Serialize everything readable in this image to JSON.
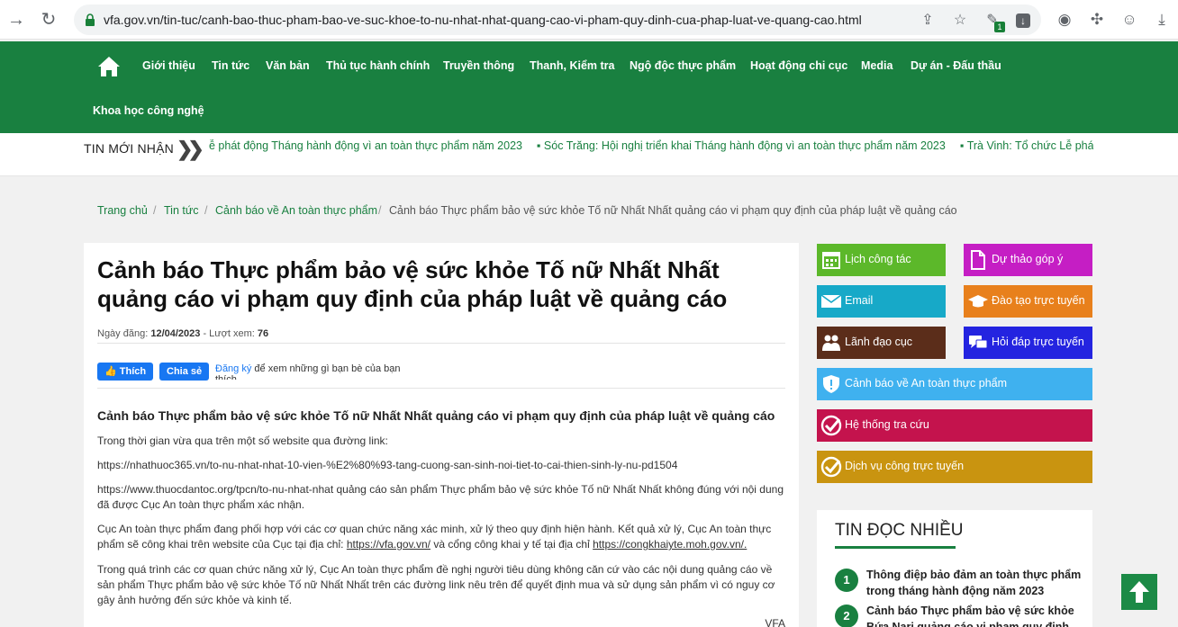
{
  "browser": {
    "url": "vfa.gov.vn/tin-tuc/canh-bao-thuc-pham-bao-ve-suc-khoe-to-nu-nhat-nhat-quang-cao-vi-pham-quy-dinh-cua-phap-luat-ve-quang-cao.html",
    "extension_badge": "1",
    "icons": [
      "back-icon",
      "reload-icon",
      "lock-icon",
      "share-icon",
      "star-icon",
      "extension-icon",
      "download-icon",
      "camera-icon",
      "puzzle-icon",
      "account-icon",
      "install-icon"
    ]
  },
  "nav": {
    "home_icon": "home-icon",
    "items": [
      "Giới thiệu",
      "Tin tức",
      "Văn bản",
      "Thủ tục hành chính",
      "Truyền thông",
      "Thanh, Kiểm tra",
      "Ngộ độc thực phẩm",
      "Hoạt động chi cục",
      "Media",
      "Dự án - Đấu thầu",
      "Khoa học công nghệ"
    ]
  },
  "ticker": {
    "title": "TIN MỚI NHẬN",
    "items": [
      "ễ phát động Tháng hành động vì an toàn thực phẩm năm 2023",
      "Sóc Trăng: Hội nghị triển khai Tháng hành động vì an toàn thực phẩm năm 2023",
      "Trà Vinh: Tổ chức Lễ phá"
    ]
  },
  "breadcrumb": [
    "Trang chủ",
    "Tin tức",
    "Cảnh báo về An toàn thực phẩm",
    "Cảnh báo Thực phẩm bảo vệ sức khỏe Tố nữ Nhất Nhất quảng cáo vi phạm quy định của pháp luật về quảng cáo"
  ],
  "article": {
    "title": "Cảnh báo Thực phẩm bảo vệ sức khỏe Tố nữ Nhất Nhất quảng cáo vi phạm quy định của pháp luật về quảng cáo",
    "date_label": "Ngày đăng: ",
    "date": "12/04/2023",
    "views_label": " - Lượt xem: ",
    "views": "76",
    "fb_like": "Thích",
    "fb_share": "Chia sẻ",
    "fb_signup": "Đăng ký",
    "fb_text": " để xem những gì bạn bè của bạn thích.",
    "lead": "Cảnh báo Thực phẩm bảo vệ sức khỏe Tố nữ Nhất Nhất quảng cáo vi phạm quy định của pháp luật về quảng cáo",
    "p1": "Trong thời gian vừa qua trên một số website qua đường link:",
    "p2": "https://nhathuoc365.vn/to-nu-nhat-nhat-10-vien-%E2%80%93-tang-cuong-san-sinh-noi-tiet-to-cai-thien-sinh-ly-nu-pd1504",
    "p3": "https://www.thuocdantoc.org/tpcn/to-nu-nhat-nhat quảng cáo sản phẩm Thực phẩm bảo vệ sức khỏe Tố nữ Nhất Nhất không đúng với nội dung đã được Cục An toàn thực phẩm xác nhận.",
    "p4_a": "Cục An toàn thực phẩm đang phối hợp với các cơ quan chức năng xác minh, xử lý theo quy định hiện hành. Kết quả xử lý, Cục An toàn thực phẩm sẽ công khai trên website của Cục tại địa chỉ: ",
    "p4_link1": "https://vfa.gov.vn/",
    "p4_b": " và cổng công khai y tế tại địa chỉ ",
    "p4_link2": "https://congkhaiyte.moh.gov.vn/.",
    "p5": "Trong quá trình các cơ quan chức năng xử lý, Cục An toàn thực phẩm đề nghị người tiêu dùng không căn cứ vào các nội dung quảng cáo về sản phẩm Thực phẩm bảo vệ sức khỏe Tố nữ Nhất Nhất trên các đường link nêu trên để quyết định mua và sử dụng sản phẩm vì có nguy cơ gây ảnh hưởng đến sức khỏe và kinh tế.",
    "source": "VFA"
  },
  "sidebar": {
    "tiles": [
      {
        "label": "Lịch công tác",
        "icon": "calendar-icon",
        "color": "#5cb82a"
      },
      {
        "label": "Dự thảo góp ý",
        "icon": "document-icon",
        "color": "#c51ec4"
      },
      {
        "label": "Email",
        "icon": "envelope-icon",
        "color": "#17a9c8"
      },
      {
        "label": "Đào tạo trực tuyến",
        "icon": "graduation-cap-icon",
        "color": "#e8801c"
      },
      {
        "label": "Lãnh đạo cục",
        "icon": "people-icon",
        "color": "#5b2d1a"
      },
      {
        "label": "Hỏi đáp trực tuyến",
        "icon": "chat-icon",
        "color": "#2424e0"
      },
      {
        "label": "Cảnh báo về An toàn thực phẩm",
        "icon": "shield-alert-icon",
        "color": "#3fb1ef"
      },
      {
        "label": "Hệ thống tra cứu",
        "icon": "check-circle-icon",
        "color": "#c4134d"
      },
      {
        "label": "Dịch vụ công trực tuyến",
        "icon": "check-circle-icon",
        "color": "#c99410"
      }
    ],
    "popular_title": "TIN ĐỌC NHIỀU",
    "popular": [
      {
        "num": "1",
        "text": "Thông điệp bảo đảm an toàn thực phẩm trong tháng hành động năm 2023"
      },
      {
        "num": "2",
        "text": "Cảnh báo Thực phẩm bảo vệ sức khỏe Bứa Nari quảng cáo vi phạm quy định"
      }
    ]
  },
  "colors": {
    "brand": "#198040",
    "link": "#198040"
  }
}
